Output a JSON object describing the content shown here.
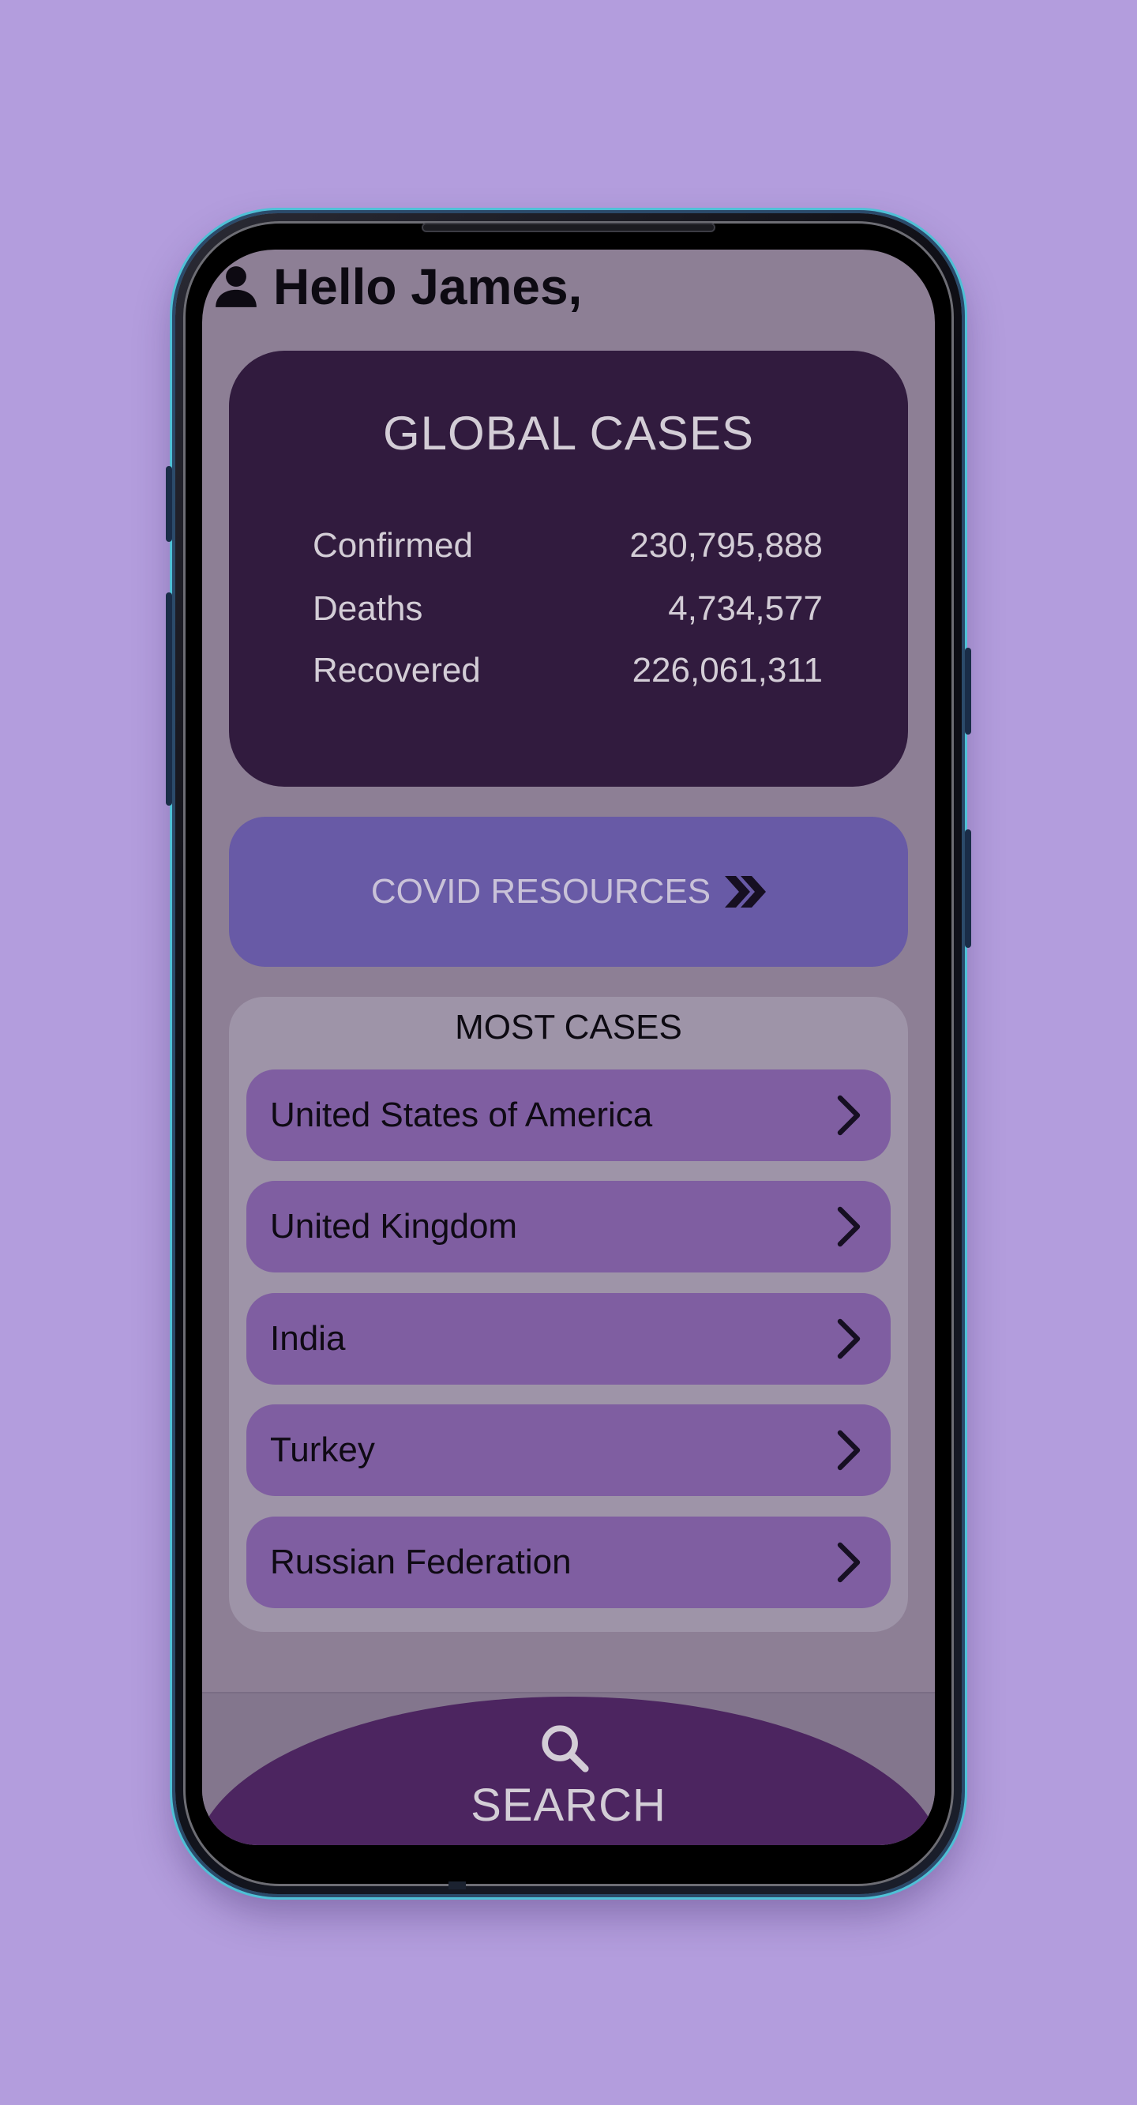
{
  "colors": {
    "background": "#b39ddd",
    "screen": "#8d7f95",
    "global_card": "#311b3e",
    "resources_button": "#685aa6",
    "most_cases_card": "#9e94a8",
    "country_item": "#7f5ea1",
    "search_bar": "#4c2560"
  },
  "header": {
    "greeting": "Hello James,",
    "icon": "person-icon"
  },
  "global_cases": {
    "title": "GLOBAL CASES",
    "stats": [
      {
        "label": "Confirmed",
        "value": "230,795,888"
      },
      {
        "label": "Deaths",
        "value": "4,734,577"
      },
      {
        "label": "Recovered",
        "value": "226,061,311"
      }
    ]
  },
  "resources": {
    "label": "COVID RESOURCES",
    "icon": "chevron-double-right-icon"
  },
  "most_cases": {
    "title": "MOST CASES",
    "countries": [
      {
        "label": "United States of America",
        "icon": "chevron-right-icon"
      },
      {
        "label": "United Kingdom",
        "icon": "chevron-right-icon"
      },
      {
        "label": "India",
        "icon": "chevron-right-icon"
      },
      {
        "label": "Turkey",
        "icon": "chevron-right-icon"
      },
      {
        "label": "Russian Federation",
        "icon": "chevron-right-icon"
      }
    ]
  },
  "search": {
    "label": "SEARCH",
    "icon": "search-icon"
  }
}
